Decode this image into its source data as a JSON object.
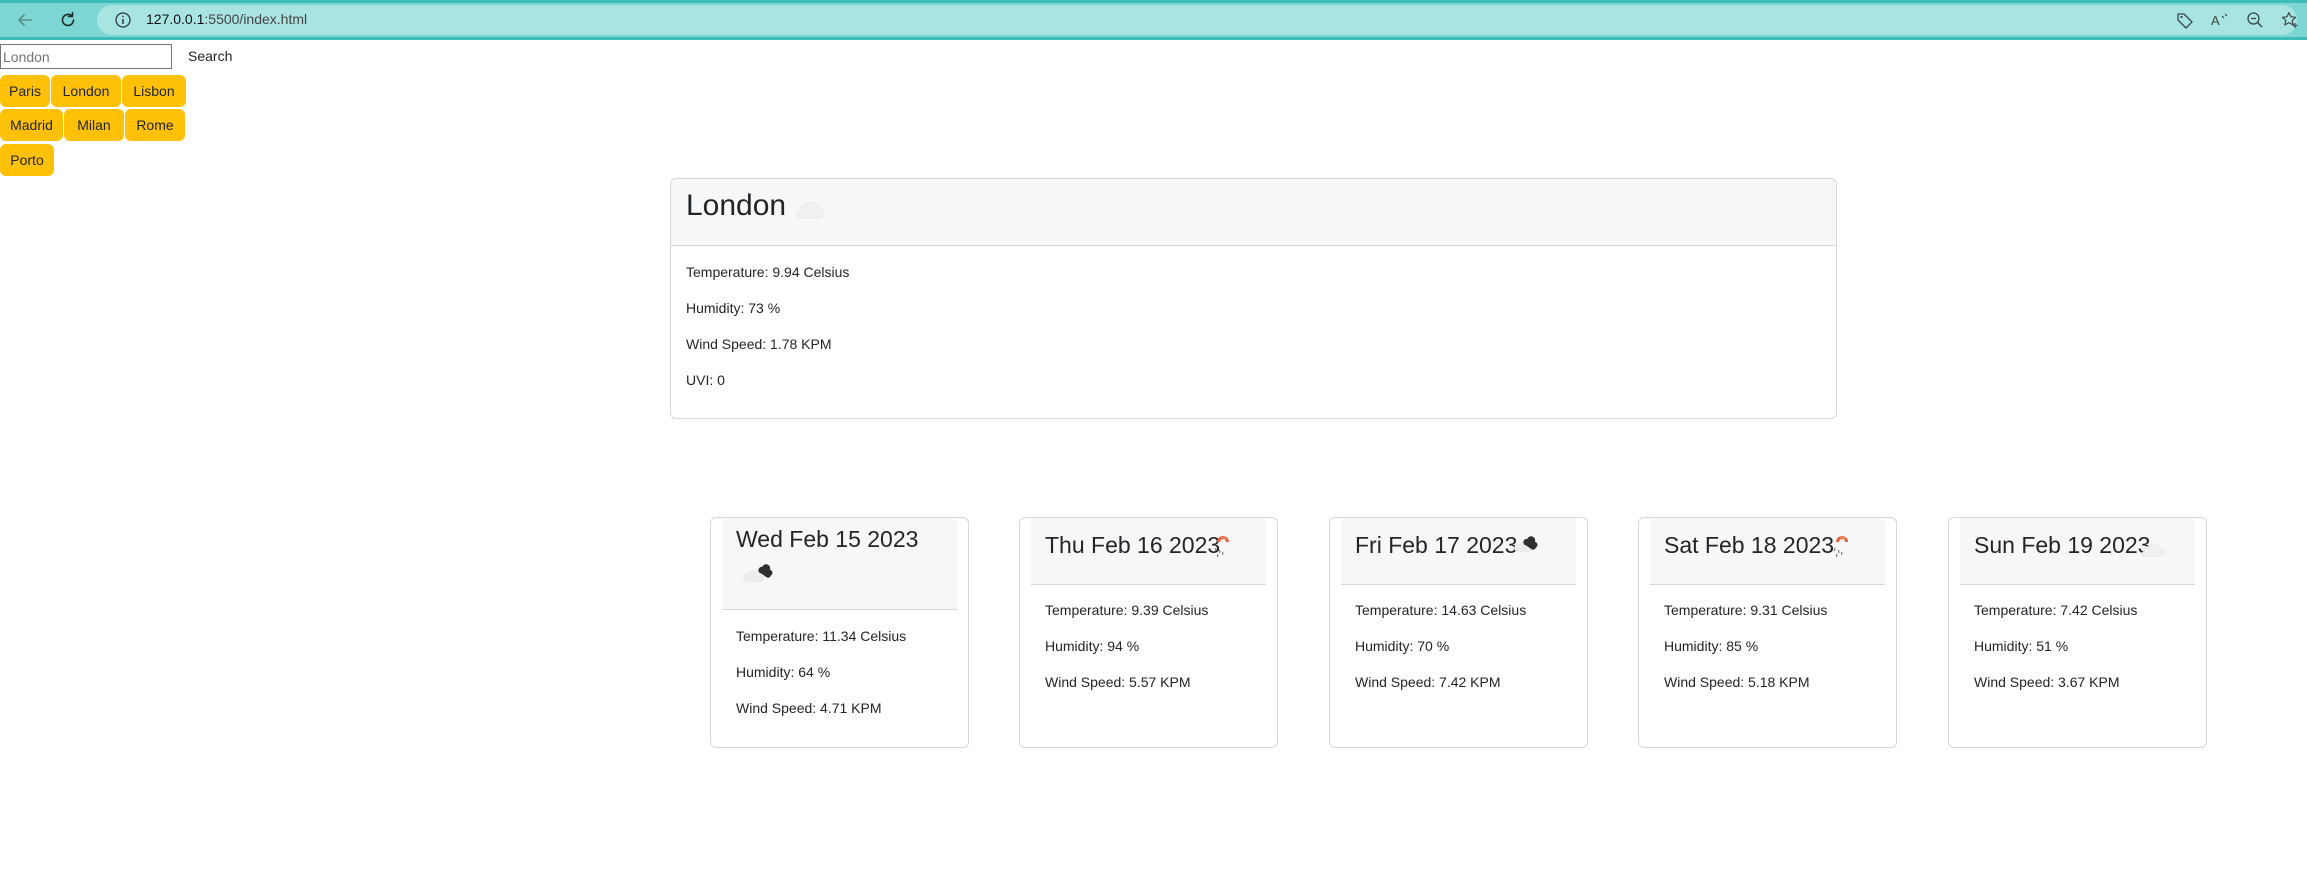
{
  "browser": {
    "url_host": "127.0.0.1",
    "url_rest": ":5500/index.html",
    "icons": [
      "back-arrow-icon",
      "reload-icon",
      "info-icon",
      "tag-icon",
      "read-aloud-icon",
      "zoom-out-icon",
      "favorite-icon"
    ]
  },
  "search": {
    "placeholder": "London",
    "value": "",
    "button_label": "Search"
  },
  "cities": [
    "Paris",
    "London",
    "Lisbon",
    "Madrid",
    "Milan",
    "Rome",
    "Porto"
  ],
  "current": {
    "city": "London",
    "icon": "cloud-icon",
    "temperature": "Temperature: 9.94 Celsius",
    "humidity": "Humidity: 73 %",
    "wind": "Wind Speed: 1.78 KPM",
    "uvi": "UVI: 0"
  },
  "forecast": [
    {
      "date": "Wed Feb 15 2023",
      "icon": "cloud-icon",
      "temperature": "Temperature: 11.34 Celsius",
      "humidity": "Humidity: 64 %",
      "wind": "Wind Speed: 4.71 KPM"
    },
    {
      "date": "Thu Feb 16 2023",
      "icon": "sun-rain-icon",
      "temperature": "Temperature: 9.39 Celsius",
      "humidity": "Humidity: 94 %",
      "wind": "Wind Speed: 5.57 KPM"
    },
    {
      "date": "Fri Feb 17 2023",
      "icon": "cloud-icon",
      "temperature": "Temperature: 14.63 Celsius",
      "humidity": "Humidity: 70 %",
      "wind": "Wind Speed: 7.42 KPM"
    },
    {
      "date": "Sat Feb 18 2023",
      "icon": "sun-rain-icon",
      "temperature": "Temperature: 9.31 Celsius",
      "humidity": "Humidity: 85 %",
      "wind": "Wind Speed: 5.18 KPM"
    },
    {
      "date": "Sun Feb 19 2023",
      "icon": "cloud-icon",
      "temperature": "Temperature: 7.42 Celsius",
      "humidity": "Humidity: 51 %",
      "wind": "Wind Speed: 3.67 KPM"
    }
  ],
  "colors": {
    "browser_bar": "#7dd6d4",
    "city_button": "#ffc107",
    "card_header": "#f7f7f7",
    "card_border": "#d7d7d7"
  }
}
